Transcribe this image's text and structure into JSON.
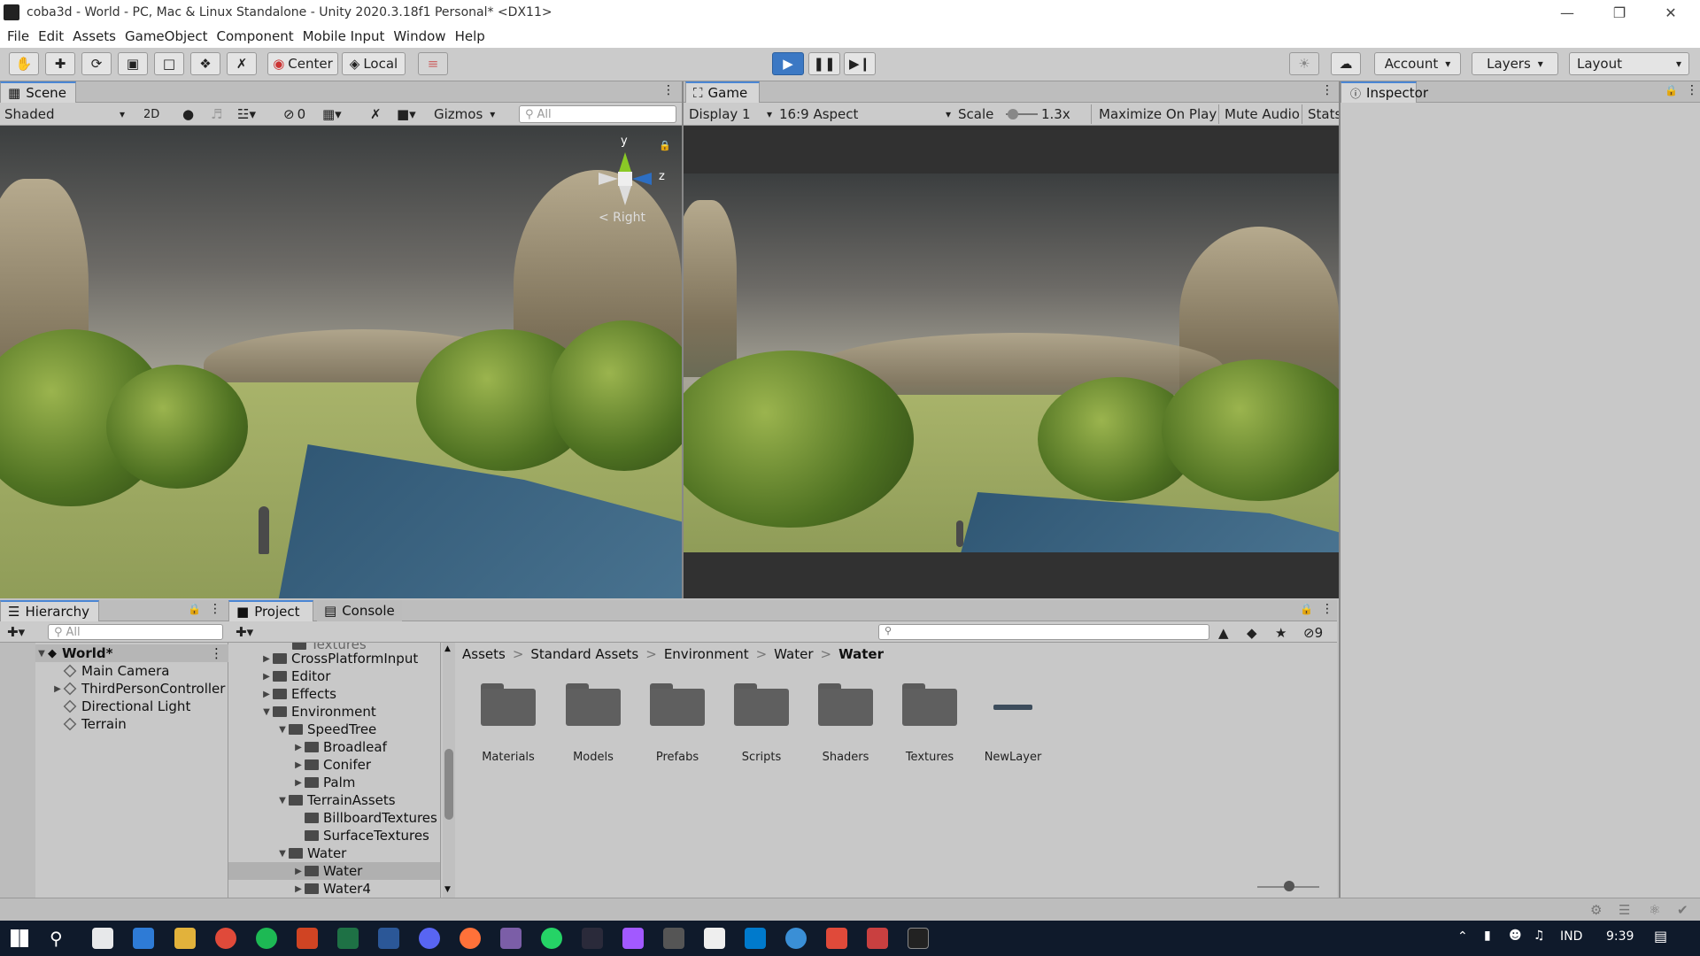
{
  "window": {
    "title": "coba3d - World - PC, Mac & Linux Standalone - Unity 2020.3.18f1 Personal* <DX11>"
  },
  "menu": [
    "File",
    "Edit",
    "Assets",
    "GameObject",
    "Component",
    "Mobile Input",
    "Window",
    "Help"
  ],
  "toolbar": {
    "center": "Center",
    "local": "Local",
    "account": "Account",
    "layers": "Layers",
    "layout": "Layout"
  },
  "scene": {
    "tab": "Scene",
    "shading": "Shaded",
    "mode2d": "2D",
    "hidden_count": "0",
    "gizmos": "Gizmos",
    "search_placeholder": "All",
    "axis_y": "y",
    "axis_z": "z",
    "view_label": "< Right"
  },
  "game": {
    "tab": "Game",
    "display": "Display 1",
    "aspect": "16:9 Aspect",
    "scale_label": "Scale",
    "scale_value": "1.3x",
    "maximize": "Maximize On Play",
    "mute": "Mute Audio",
    "stats": "Stats"
  },
  "inspector": {
    "tab": "Inspector"
  },
  "hierarchy": {
    "tab": "Hierarchy",
    "search_placeholder": "All",
    "scene_name": "World*",
    "items": [
      "Main Camera",
      "ThirdPersonController",
      "Directional Light",
      "Terrain"
    ]
  },
  "project": {
    "tab": "Project",
    "console_tab": "Console",
    "hidden_count": "9",
    "tree": [
      {
        "label": "Textures",
        "depth": 2,
        "arrow": ""
      },
      {
        "label": "CrossPlatformInput",
        "depth": 1,
        "arrow": "▶"
      },
      {
        "label": "Editor",
        "depth": 1,
        "arrow": "▶"
      },
      {
        "label": "Effects",
        "depth": 1,
        "arrow": "▶"
      },
      {
        "label": "Environment",
        "depth": 1,
        "arrow": "▼"
      },
      {
        "label": "SpeedTree",
        "depth": 2,
        "arrow": "▼"
      },
      {
        "label": "Broadleaf",
        "depth": 3,
        "arrow": "▶"
      },
      {
        "label": "Conifer",
        "depth": 3,
        "arrow": "▶"
      },
      {
        "label": "Palm",
        "depth": 3,
        "arrow": "▶"
      },
      {
        "label": "TerrainAssets",
        "depth": 2,
        "arrow": "▼"
      },
      {
        "label": "BillboardTextures",
        "depth": 3,
        "arrow": ""
      },
      {
        "label": "SurfaceTextures",
        "depth": 3,
        "arrow": ""
      },
      {
        "label": "Water",
        "depth": 2,
        "arrow": "▼"
      },
      {
        "label": "Water",
        "depth": 3,
        "arrow": "▶",
        "selected": true
      },
      {
        "label": "Water4",
        "depth": 3,
        "arrow": "▶"
      }
    ],
    "breadcrumb": [
      "Assets",
      "Standard Assets",
      "Environment",
      "Water",
      "Water"
    ],
    "assets": [
      "Materials",
      "Models",
      "Prefabs",
      "Scripts",
      "Shaders",
      "Textures",
      "NewLayer"
    ]
  },
  "taskbar": {
    "lang": "IND",
    "time": "9:39"
  }
}
